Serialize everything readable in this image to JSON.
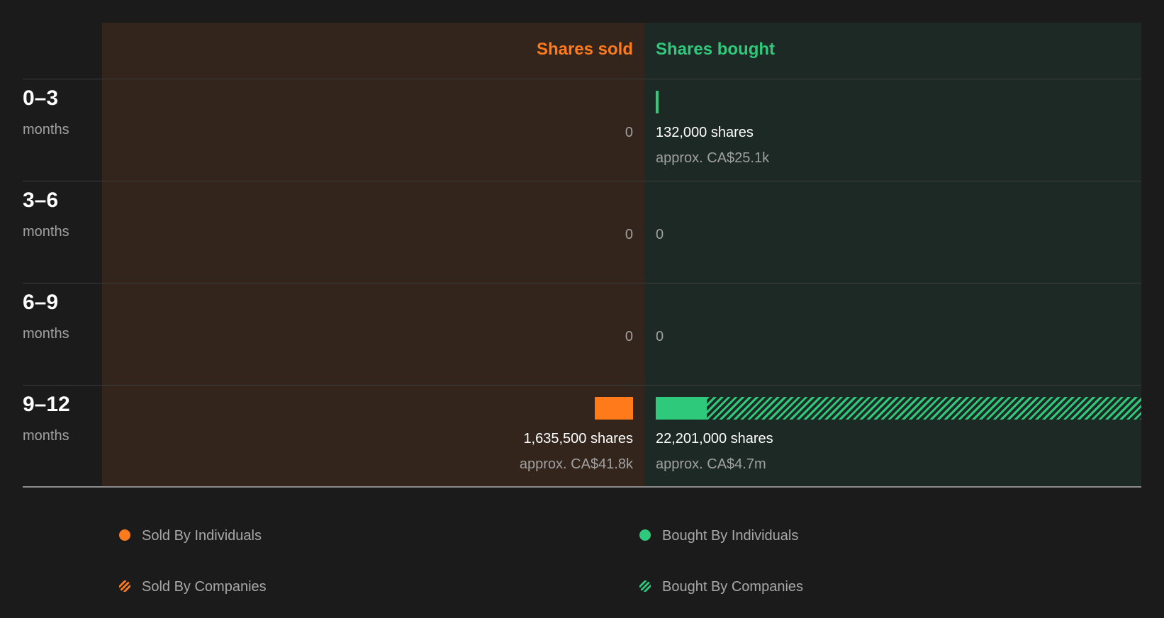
{
  "colors": {
    "sold": "#ff7a1a",
    "bought": "#2ec97a",
    "sold_panel": "#33241c",
    "bought_panel": "#1d2924"
  },
  "chart_data": {
    "type": "bar",
    "headers": {
      "sold": "Shares sold",
      "bought": "Shares bought"
    },
    "periods": [
      {
        "label": "0–3",
        "unit": "months",
        "sold": {
          "individuals": 0,
          "companies": 0,
          "shares_text": "0",
          "approx_text": ""
        },
        "bought": {
          "individuals": 132000,
          "companies": 0,
          "shares_text": "132,000 shares",
          "approx_text": "approx. CA$25.1k"
        }
      },
      {
        "label": "3–6",
        "unit": "months",
        "sold": {
          "individuals": 0,
          "companies": 0,
          "shares_text": "0",
          "approx_text": ""
        },
        "bought": {
          "individuals": 0,
          "companies": 0,
          "shares_text": "0",
          "approx_text": ""
        }
      },
      {
        "label": "6–9",
        "unit": "months",
        "sold": {
          "individuals": 0,
          "companies": 0,
          "shares_text": "0",
          "approx_text": ""
        },
        "bought": {
          "individuals": 0,
          "companies": 0,
          "shares_text": "0",
          "approx_text": ""
        }
      },
      {
        "label": "9–12",
        "unit": "months",
        "sold": {
          "individuals": 1635500,
          "companies": 0,
          "shares_text": "1,635,500 shares",
          "approx_text": "approx. CA$41.8k"
        },
        "bought": {
          "individuals": 2330000,
          "companies": 19871000,
          "shares_text": "22,201,000 shares",
          "approx_text": "approx. CA$4.7m"
        }
      }
    ],
    "scale_max": 22201000,
    "legend": {
      "sold_individuals": "Sold By Individuals",
      "bought_individuals": "Bought By Individuals",
      "sold_companies": "Sold By Companies",
      "bought_companies": "Bought By Companies"
    }
  }
}
